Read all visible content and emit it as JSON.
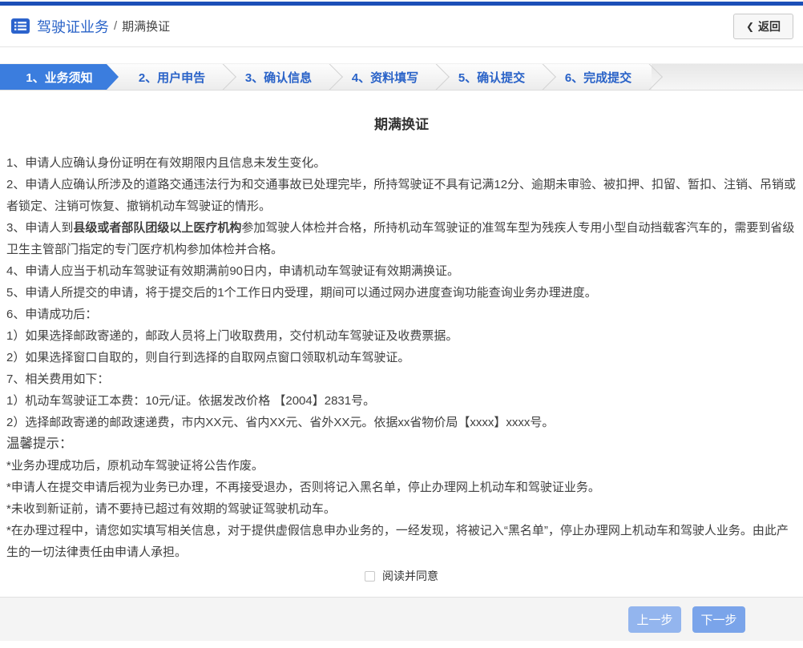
{
  "header": {
    "breadcrumb": {
      "primary": "驾驶证业务",
      "separator": "/",
      "secondary": "期满换证"
    },
    "back": {
      "chevron": "❮",
      "label": "返回"
    }
  },
  "steps": [
    {
      "label": "1、业务须知",
      "active": true
    },
    {
      "label": "2、用户申告",
      "active": false
    },
    {
      "label": "3、确认信息",
      "active": false
    },
    {
      "label": "4、资料填写",
      "active": false
    },
    {
      "label": "5、确认提交",
      "active": false
    },
    {
      "label": "6、完成提交",
      "active": false
    }
  ],
  "content": {
    "title": "期满换证",
    "lines": [
      {
        "text": "1、申请人应确认身份证明在有效期限内且信息未发生变化。"
      },
      {
        "text": "2、申请人应确认所涉及的道路交通违法行为和交通事故已处理完毕，所持驾驶证不具有记满12分、逾期未审验、被扣押、扣留、暂扣、注销、吊销或者锁定、注销可恢复、撤销机动车驾驶证的情形。"
      },
      {
        "prefix": "3、申请人到",
        "bold": "县级或者部队团级以上医疗机构",
        "suffix": "参加驾驶人体检并合格，所持机动车驾驶证的准驾车型为残疾人专用小型自动挡载客汽车的，需要到省级卫生主管部门指定的专门医疗机构参加体检并合格。"
      },
      {
        "text": "4、申请人应当于机动车驾驶证有效期满前90日内，申请机动车驾驶证有效期满换证。"
      },
      {
        "text": "5、申请人所提交的申请，将于提交后的1个工作日内受理，期间可以通过网办进度查询功能查询业务办理进度。"
      },
      {
        "text": "6、申请成功后："
      },
      {
        "text": "1）如果选择邮政寄递的，邮政人员将上门收取费用，交付机动车驾驶证及收费票据。"
      },
      {
        "text": "2）如果选择窗口自取的，则自行到选择的自取网点窗口领取机动车驾驶证。"
      },
      {
        "text": "7、相关费用如下："
      },
      {
        "text": "1）机动车驾驶证工本费：10元/证。依据发改价格 【2004】2831号。"
      },
      {
        "text": "2）选择邮政寄递的邮政速递费，市内XX元、省内XX元、省外XX元。依据xx省物价局【xxxx】xxxx号。"
      },
      {
        "text": "温馨提示：",
        "class": "tip-title"
      },
      {
        "text": "*业务办理成功后，原机动车驾驶证将公告作废。"
      },
      {
        "text": "*申请人在提交申请后视为业务已办理，不再接受退办，否则将记入黑名单，停止办理网上机动车和驾驶证业务。"
      },
      {
        "text": "*未收到新证前，请不要持已超过有效期的驾驶证驾驶机动车。"
      },
      {
        "text": "*在办理过程中，请您如实填写相关信息，对于提供虚假信息申办业务的，一经发现，将被记入“黑名单”，停止办理网上机动车和驾驶人业务。由此产生的一切法律责任由申请人承担。"
      }
    ],
    "agree_label": "阅读并同意"
  },
  "footer": {
    "prev_label": "上一步",
    "next_label": "下一步"
  },
  "colors": {
    "top_accent": "#1b4fb8",
    "link_blue": "#2a63c8",
    "active_step_blue": "#3b7dde",
    "button_prev": "#93b5ee",
    "button_next": "#7aa4ea",
    "footer_bg": "#f4f4f4",
    "body_text": "#404040"
  }
}
